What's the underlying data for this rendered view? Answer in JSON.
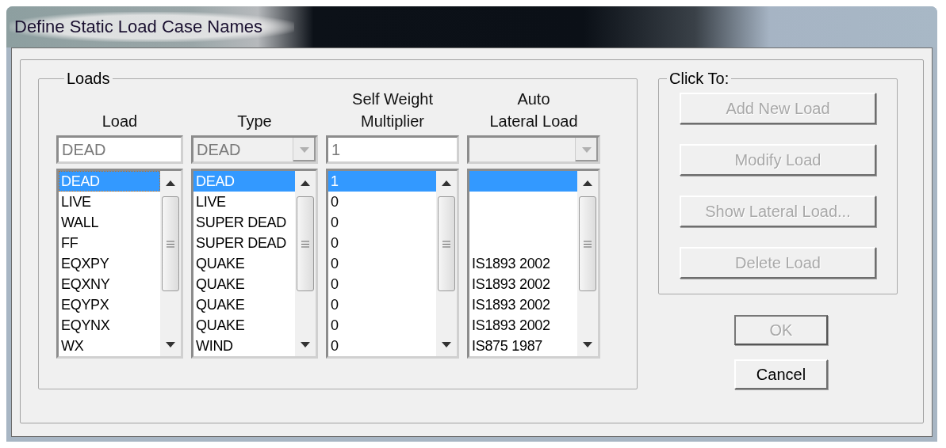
{
  "window": {
    "title": "Define Static Load Case Names"
  },
  "loads_group": {
    "label": "Loads",
    "columns": [
      {
        "header": "Load",
        "input": {
          "kind": "text",
          "value": "DEAD"
        },
        "focused": true
      },
      {
        "header": "Type",
        "input": {
          "kind": "combo",
          "value": "DEAD"
        },
        "focused": false
      },
      {
        "header": "Self Weight\nMultiplier",
        "input": {
          "kind": "text",
          "value": "1"
        },
        "focused": false
      },
      {
        "header": "Auto\nLateral Load",
        "input": {
          "kind": "combo"
        },
        "focused": false
      }
    ],
    "rows": [
      {
        "selected": true,
        "cells": [
          "DEAD",
          "DEAD",
          "1"
        ]
      },
      {
        "selected": false,
        "cells": [
          "LIVE",
          "LIVE",
          "0"
        ]
      },
      {
        "selected": false,
        "cells": [
          "WALL",
          "SUPER DEAD",
          "0"
        ]
      },
      {
        "selected": false,
        "cells": [
          "FF",
          "SUPER DEAD",
          "0"
        ]
      },
      {
        "selected": false,
        "cells": [
          "EQXPY",
          "QUAKE",
          "0",
          "IS1893 2002"
        ]
      },
      {
        "selected": false,
        "cells": [
          "EQXNY",
          "QUAKE",
          "0",
          "IS1893 2002"
        ]
      },
      {
        "selected": false,
        "cells": [
          "EQYPX",
          "QUAKE",
          "0",
          "IS1893 2002"
        ]
      },
      {
        "selected": false,
        "cells": [
          "EQYNX",
          "QUAKE",
          "0",
          "IS1893 2002"
        ]
      },
      {
        "selected": false,
        "cells": [
          "WX",
          "WIND",
          "0",
          "IS875 1987"
        ]
      }
    ]
  },
  "click_to_group": {
    "label": "Click To:",
    "buttons": [
      {
        "label": "Add New Load",
        "disabled": true
      },
      {
        "label": "Modify Load",
        "disabled": true
      },
      {
        "label": "Show Lateral Load...",
        "disabled": true
      },
      {
        "label": "Delete Load",
        "disabled": true
      }
    ]
  },
  "dialog_buttons": [
    {
      "label": "OK",
      "disabled": true
    },
    {
      "label": "Cancel",
      "disabled": false
    }
  ]
}
